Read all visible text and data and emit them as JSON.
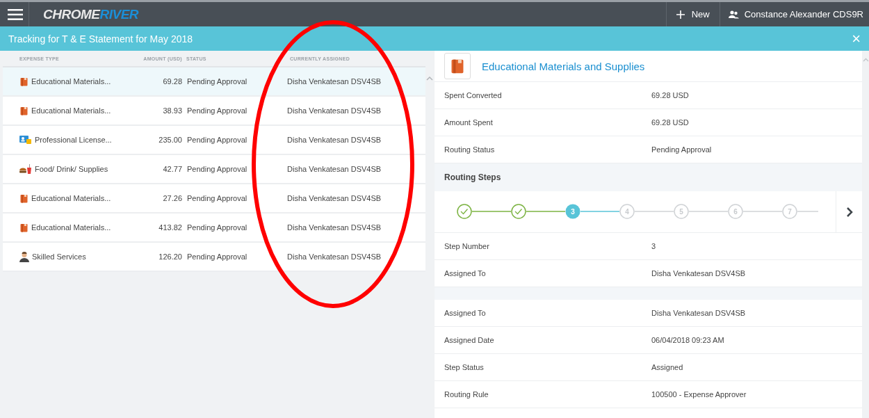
{
  "top_bar": {
    "logo_left": "CHROME",
    "logo_right": "RIVER",
    "new_button": "New",
    "user": "Constance Alexander CDS9R"
  },
  "title_bar": {
    "title": "Tracking for T & E Statement for May 2018",
    "close": "×"
  },
  "table": {
    "columns": [
      "EXPENSE TYPE",
      "AMOUNT (USD)",
      "STATUS",
      "CURRENTLY ASSIGNED"
    ],
    "rows": [
      {
        "kind": "education",
        "type": "Educational Materials...",
        "amount": "69.28",
        "status": "Pending Approval",
        "assigned": "Disha Venkatesan DSV4SB",
        "selected": true
      },
      {
        "kind": "education",
        "type": "Educational Materials...",
        "amount": "38.93",
        "status": "Pending Approval",
        "assigned": "Disha Venkatesan DSV4SB",
        "selected": false
      },
      {
        "kind": "license",
        "type": "Professional License...",
        "amount": "235.00",
        "status": "Pending Approval",
        "assigned": "Disha Venkatesan DSV4SB",
        "selected": false
      },
      {
        "kind": "food",
        "type": "Food/ Drink/ Supplies",
        "amount": "42.77",
        "status": "Pending Approval",
        "assigned": "Disha Venkatesan DSV4SB",
        "selected": false
      },
      {
        "kind": "education",
        "type": "Educational Materials...",
        "amount": "27.26",
        "status": "Pending Approval",
        "assigned": "Disha Venkatesan DSV4SB",
        "selected": false
      },
      {
        "kind": "education",
        "type": "Educational Materials...",
        "amount": "413.82",
        "status": "Pending Approval",
        "assigned": "Disha Venkatesan DSV4SB",
        "selected": false
      },
      {
        "kind": "services",
        "type": "Skilled Services",
        "amount": "126.20",
        "status": "Pending Approval",
        "assigned": "Disha Venkatesan DSV4SB",
        "selected": false
      }
    ]
  },
  "detail": {
    "kind": "education",
    "title": "Educational Materials and Supplies",
    "fields": [
      {
        "label": "Spent Converted",
        "value": "69.28 USD"
      },
      {
        "label": "Amount Spent",
        "value": "69.28 USD"
      },
      {
        "label": "Routing Status",
        "value": "Pending Approval"
      }
    ],
    "routing_steps": {
      "heading": "Routing Steps",
      "steps": [
        {
          "kind": "done"
        },
        {
          "kind": "done"
        },
        {
          "kind": "current",
          "label": "3"
        },
        {
          "kind": "pending",
          "label": "4"
        },
        {
          "kind": "pending",
          "label": "5"
        },
        {
          "kind": "pending",
          "label": "6"
        },
        {
          "kind": "pending",
          "label": "7"
        }
      ]
    },
    "step_fields": [
      {
        "label": "Step Number",
        "value": "3"
      },
      {
        "label": "Assigned To",
        "value": "Disha Venkatesan DSV4SB"
      }
    ],
    "assignment_fields": [
      {
        "label": "Assigned To",
        "value": "Disha Venkatesan DSV4SB"
      },
      {
        "label": "Assigned Date",
        "value": "06/04/2018 09:23 AM"
      },
      {
        "label": "Step Status",
        "value": "Assigned"
      },
      {
        "label": "Routing Rule",
        "value": "100500 - Expense Approver"
      }
    ]
  },
  "annotation": {
    "kind": "ellipse"
  }
}
